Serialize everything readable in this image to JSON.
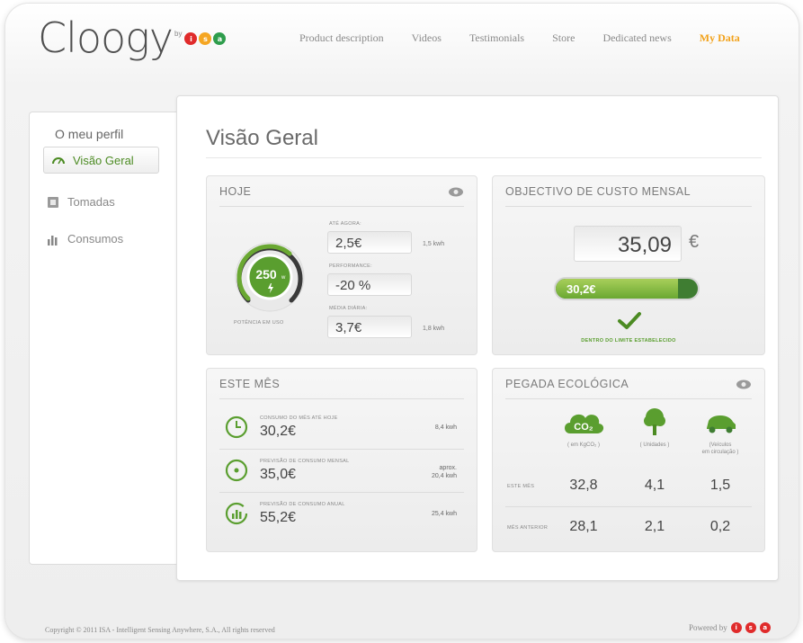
{
  "header": {
    "logo_text": "Cloogy",
    "logo_by": "by",
    "isa_letters": [
      "i",
      "s",
      "a"
    ],
    "isa_colors": [
      "#e02b2b",
      "#f5a623",
      "#2e9d4c"
    ],
    "nav": [
      "Product description",
      "Videos",
      "Testimonials",
      "Store",
      "Dedicated news",
      "My Data"
    ],
    "nav_active_index": 5,
    "nav_active_color": "#f2a21b"
  },
  "sidebar": {
    "title": "O meu perfil",
    "items": [
      {
        "label": "Visão Geral",
        "icon": "gauge-icon",
        "active": true
      },
      {
        "label": "Tomadas",
        "icon": "socket-icon",
        "active": false
      },
      {
        "label": "Consumos",
        "icon": "bar-chart-icon",
        "active": false
      }
    ]
  },
  "main": {
    "title": "Visão Geral",
    "hoje": {
      "title": "HOJE",
      "gauge_value": "250",
      "gauge_unit": "w",
      "gauge_level": 0.65,
      "gauge_caption": "POTÊNCIA EM USO",
      "fields": [
        {
          "label": "ATÉ AGORA:",
          "value": "2,5€",
          "side": "1,5 kwh"
        },
        {
          "label": "PERFORMANCE:",
          "value": "-20 %",
          "side": ""
        },
        {
          "label": "MÉDIA DIÁRIA:",
          "value": "3,7€",
          "side": "1,8 kwh"
        }
      ]
    },
    "objectivo": {
      "title": "OBJECTIVO DE CUSTO MENSAL",
      "target": "35,09",
      "currency": "€",
      "progress_label": "30,2€",
      "progress_fraction": 0.86,
      "status": "DENTRO DO LIMITE ESTABELECIDO",
      "accent": "#5a9e2f"
    },
    "este_mes": {
      "title": "ESTE MÊS",
      "rows": [
        {
          "label": "CONSUMO DO MÊS ATÉ HOJE",
          "value": "30,2€",
          "right": [
            "8,4 kwh"
          ],
          "icon": "clock-icon"
        },
        {
          "label": "PREVISÃO DE CONSUMO MENSAL",
          "value": "35,0€",
          "right": [
            "aprox.",
            "20,4 kwh"
          ],
          "icon": "target-icon"
        },
        {
          "label": "PREVISÃO DE CONSUMO ANUAL",
          "value": "55,2€",
          "right": [
            "25,4 kwh"
          ],
          "icon": "annual-chart-icon"
        }
      ]
    },
    "pegada": {
      "title": "PEGADA ECOLÓGICA",
      "columns": [
        {
          "icon": "co2-cloud-icon",
          "badge": "CO₂",
          "sub": [
            "( em KgCO₂ )"
          ]
        },
        {
          "icon": "tree-icon",
          "badge": "",
          "sub": [
            "( Unidades )"
          ]
        },
        {
          "icon": "car-icon",
          "badge": "",
          "sub": [
            "(Veículos",
            "em circulação )"
          ]
        }
      ],
      "rows": [
        {
          "label": "ESTE MÊS",
          "values": [
            "32,8",
            "4,1",
            "1,5"
          ]
        },
        {
          "label": "MÊS ANTERIOR",
          "values": [
            "28,1",
            "2,1",
            "0,2"
          ]
        }
      ]
    }
  },
  "footer": {
    "copyright": "Copyright © 2011 ISA - Intelligent Sensing Anywhere, S.A., All rights reserved",
    "powered": "Powered by",
    "letters": [
      "i",
      "s",
      "a"
    ]
  }
}
